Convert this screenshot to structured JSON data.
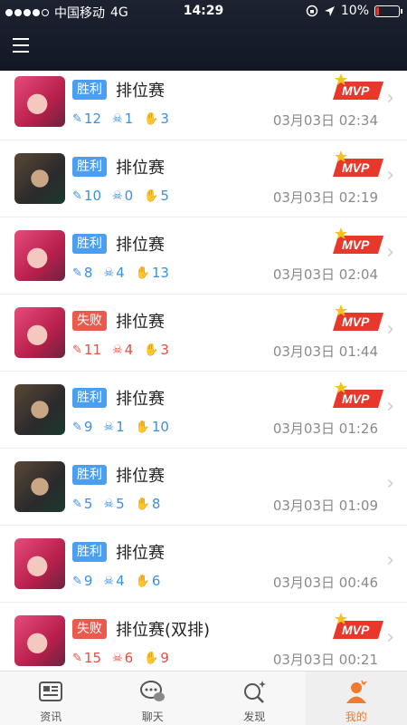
{
  "status_bar": {
    "carrier": "中国移动",
    "network": "4G",
    "time": "14:29",
    "battery": "10%",
    "battery_level": 0.1,
    "signal_bars": 4
  },
  "header": {
    "menu_icon": "hamburger-menu-icon"
  },
  "colors": {
    "win": "#4a9ff2",
    "lose": "#ec5a4d",
    "mvp": "#e8382c",
    "active_tab": "#f07a2e"
  },
  "matches": [
    {
      "hero": "pink",
      "result": "胜利",
      "outcome": "win",
      "mode": "排位赛",
      "kills": "12",
      "deaths": "1",
      "assists": "3",
      "time": "03月03日 02:34",
      "mvp": true,
      "mvp_label": "MVP"
    },
    {
      "hero": "dark",
      "result": "胜利",
      "outcome": "win",
      "mode": "排位赛",
      "kills": "10",
      "deaths": "0",
      "assists": "5",
      "time": "03月03日 02:19",
      "mvp": true,
      "mvp_label": "MVP"
    },
    {
      "hero": "pink",
      "result": "胜利",
      "outcome": "win",
      "mode": "排位赛",
      "kills": "8",
      "deaths": "4",
      "assists": "13",
      "time": "03月03日 02:04",
      "mvp": true,
      "mvp_label": "MVP"
    },
    {
      "hero": "pink",
      "result": "失败",
      "outcome": "lose",
      "mode": "排位赛",
      "kills": "11",
      "deaths": "4",
      "assists": "3",
      "time": "03月03日 01:44",
      "mvp": true,
      "mvp_label": "MVP"
    },
    {
      "hero": "dark",
      "result": "胜利",
      "outcome": "win",
      "mode": "排位赛",
      "kills": "9",
      "deaths": "1",
      "assists": "10",
      "time": "03月03日 01:26",
      "mvp": true,
      "mvp_label": "MVP"
    },
    {
      "hero": "dark",
      "result": "胜利",
      "outcome": "win",
      "mode": "排位赛",
      "kills": "5",
      "deaths": "5",
      "assists": "8",
      "time": "03月03日 01:09",
      "mvp": false
    },
    {
      "hero": "pink",
      "result": "胜利",
      "outcome": "win",
      "mode": "排位赛",
      "kills": "9",
      "deaths": "4",
      "assists": "6",
      "time": "03月03日 00:46",
      "mvp": false
    },
    {
      "hero": "pink",
      "result": "失败",
      "outcome": "lose",
      "mode": "排位赛(双排)",
      "kills": "15",
      "deaths": "6",
      "assists": "9",
      "time": "03月03日 00:21",
      "mvp": true,
      "mvp_label": "MVP"
    }
  ],
  "tabs": [
    {
      "label": "资讯",
      "icon": "news-icon",
      "active": false
    },
    {
      "label": "聊天",
      "icon": "chat-icon",
      "active": false
    },
    {
      "label": "发现",
      "icon": "discover-icon",
      "active": false
    },
    {
      "label": "我的",
      "icon": "profile-icon",
      "active": true
    }
  ]
}
